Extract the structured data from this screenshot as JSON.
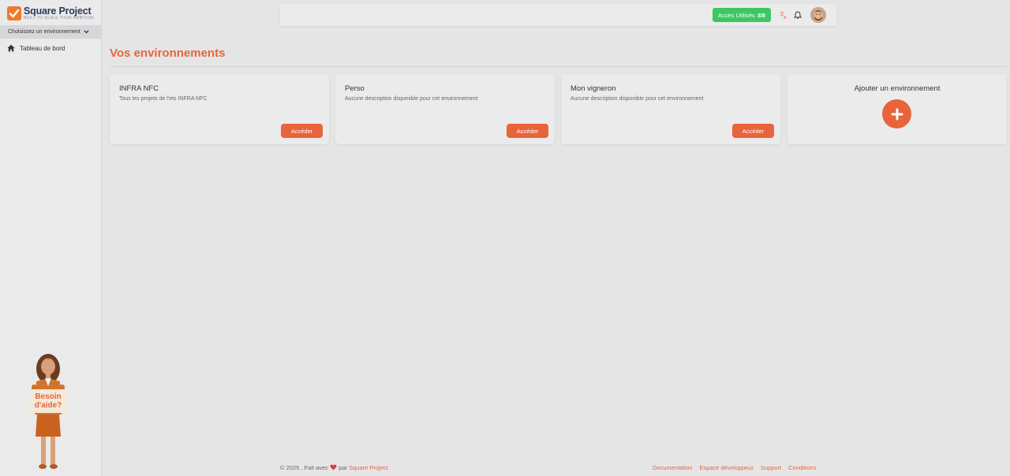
{
  "brand": {
    "name": "Square Project",
    "tagline": "BUILT TO SCALE YOUR AMBITION",
    "accent_color": "#f07a2a"
  },
  "sidebar": {
    "env_select_label": "Choisissez un environnement",
    "items": [
      {
        "label": "Tableau de bord",
        "icon": "home-icon"
      }
    ],
    "helper": {
      "sign_line1": "Besoin",
      "sign_line2": "d'aide?"
    }
  },
  "topbar": {
    "access_label": "Accès Utilisés",
    "access_count": "3/8",
    "access_color": "#3cc763",
    "icons": [
      "translate-icon",
      "bell-icon",
      "avatar"
    ]
  },
  "main": {
    "title": "Vos environnements",
    "accent_color": "#e8643a",
    "environments": [
      {
        "title": "INFRA NFC",
        "description": "Tous les projets de l'ets INFRA NFC",
        "button": "Accéder"
      },
      {
        "title": "Perso",
        "description": "Aucune description disponible pour cet environnement",
        "button": "Accéder"
      },
      {
        "title": "Mon vigneron",
        "description": "Aucune description disponible pour cet environnement",
        "button": "Accéder"
      }
    ],
    "add_card": {
      "title": "Ajouter un environnement"
    }
  },
  "footer": {
    "copyright": "© 2025 , Fait avec",
    "by": "par",
    "brand_link": "Square Project",
    "links": [
      "Documentation",
      "Espace développeur",
      "Support",
      "Conditions"
    ]
  }
}
